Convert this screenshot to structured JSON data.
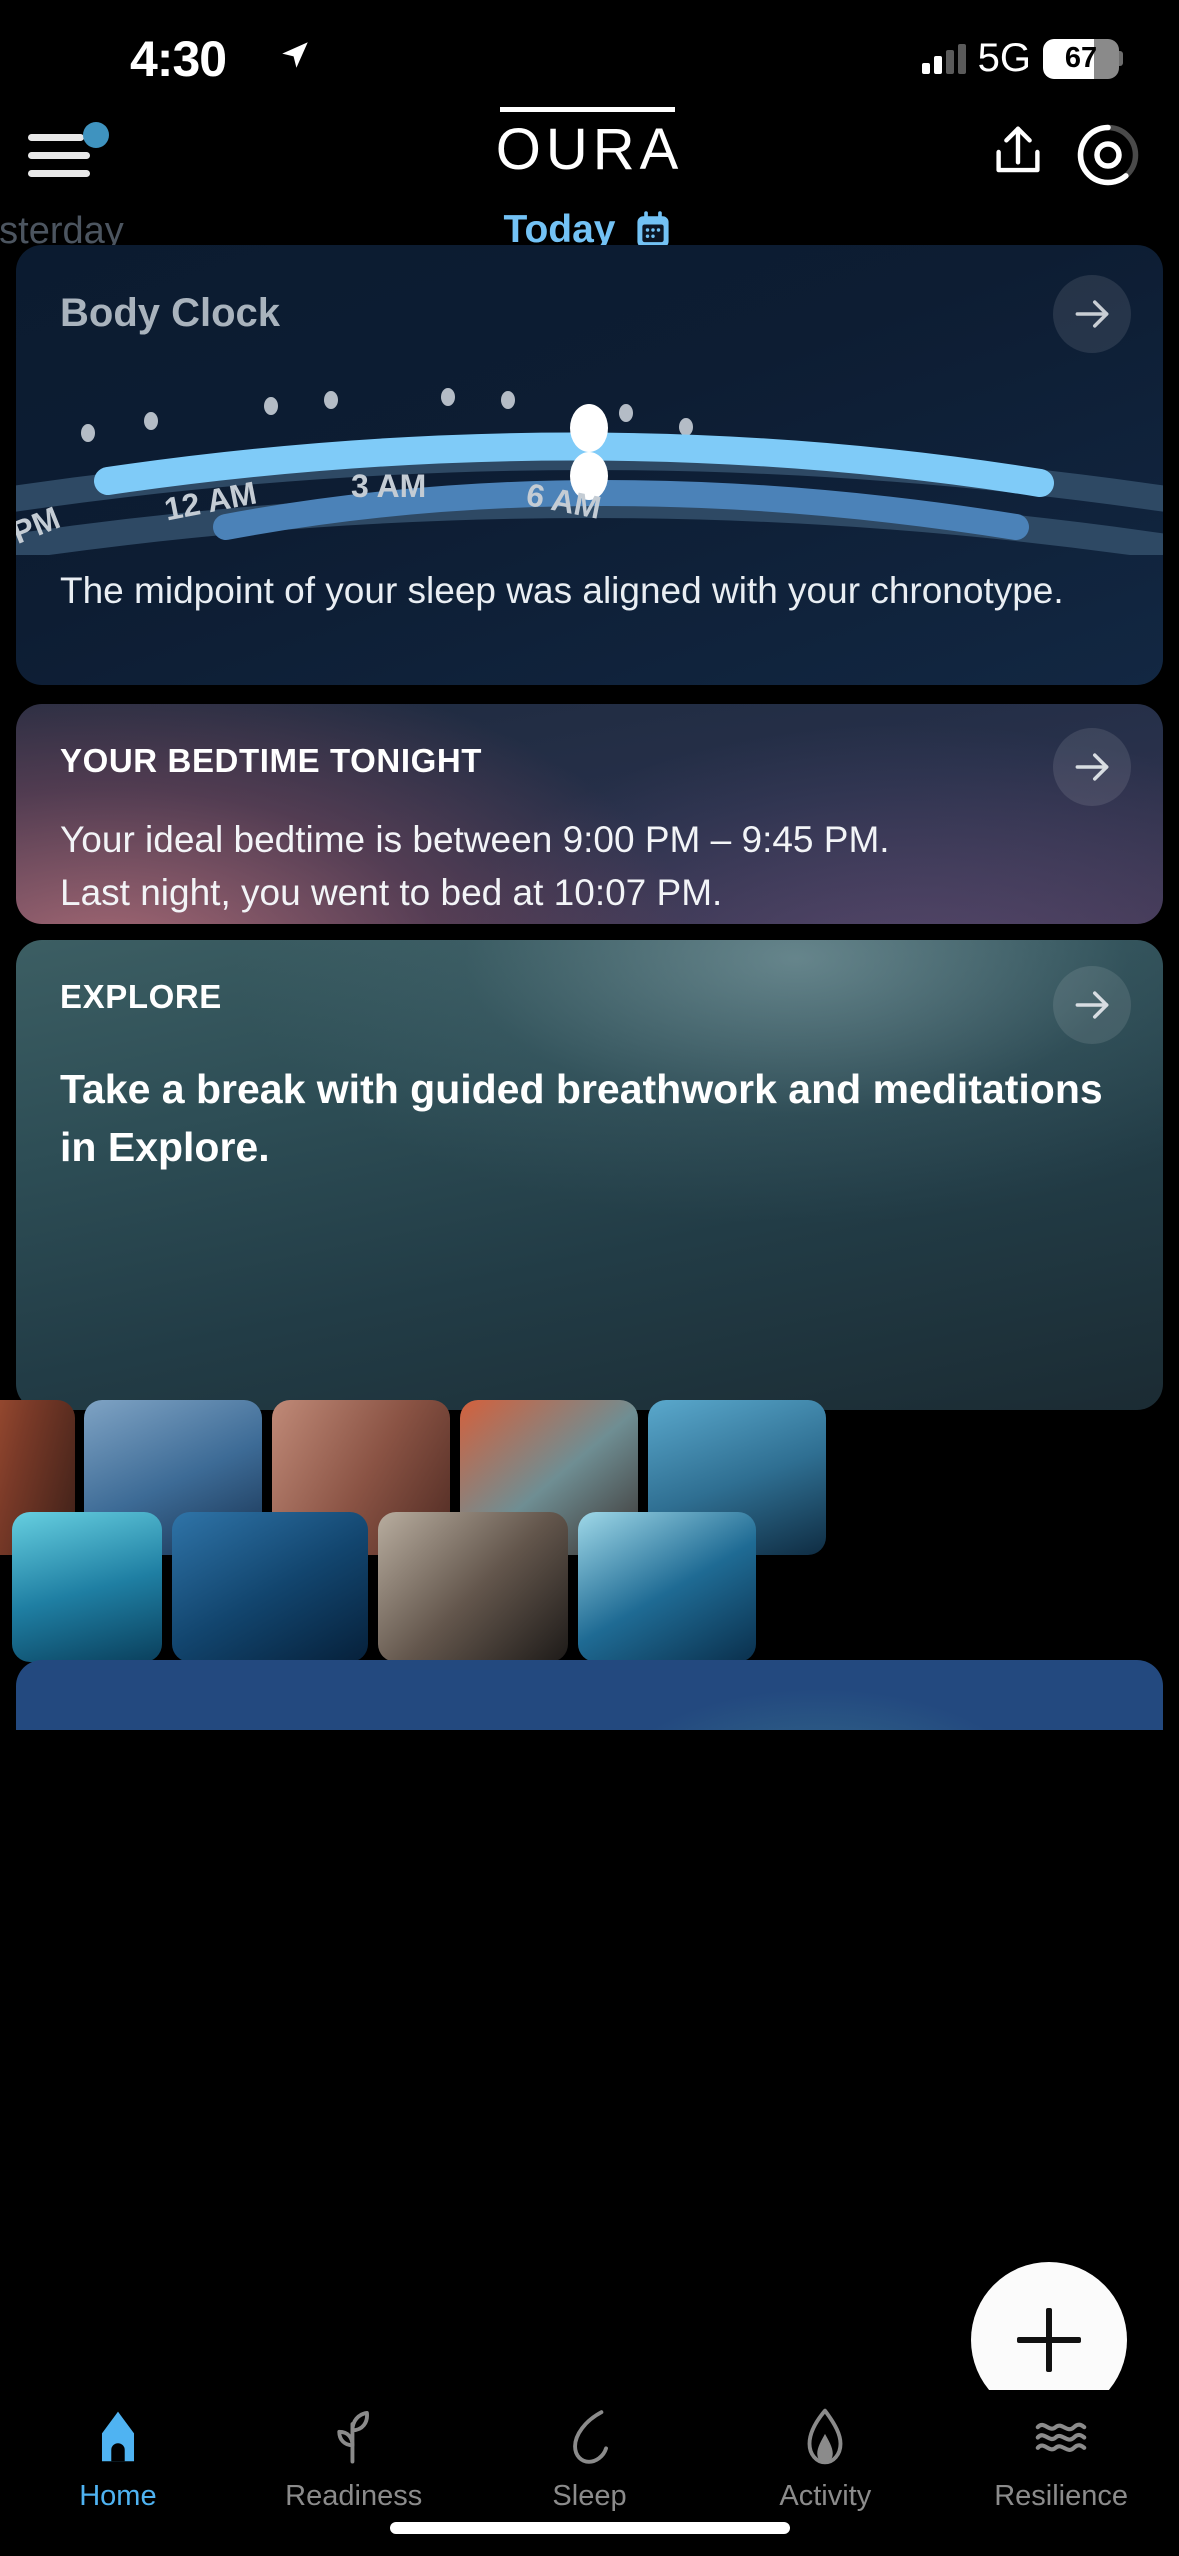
{
  "status_bar": {
    "time": "4:30",
    "location_icon": "location-arrow-icon",
    "network": "5G",
    "battery_percent": "67",
    "battery_level": 67,
    "signal_bars_filled": 2,
    "signal_bars_total": 4
  },
  "header": {
    "app_title": "OURA",
    "menu_icon": "hamburger-menu-icon",
    "menu_badge": true,
    "share_icon": "share-icon",
    "ring_icon": "ring-status-icon"
  },
  "day_tabs": {
    "previous": "esterday",
    "current": "Today",
    "calendar_icon": "calendar-icon",
    "active_color": "#73c2f5"
  },
  "body_clock": {
    "title": "Body Clock",
    "arrow_icon": "arrow-right-icon",
    "description": "The midpoint of your sleep was aligned with your chronotype.",
    "axis_labels": [
      "PM",
      "12 AM",
      "3 AM",
      "6 AM"
    ],
    "upper_arc_color": "#7fcbf8",
    "lower_arc_color": "#4b82b8",
    "track_color": "#2e4964",
    "marker_color": "#ffffff"
  },
  "bedtime": {
    "kicker": "YOUR BEDTIME TONIGHT",
    "arrow_icon": "arrow-right-icon",
    "line1": "Your ideal bedtime is between 9:00 PM – 9:45 PM.",
    "line2": "Last night, you went to bed at 10:07 PM.",
    "ideal_start": "9:00 PM",
    "ideal_end": "9:45 PM",
    "actual_bedtime": "10:07 PM"
  },
  "explore": {
    "kicker": "EXPLORE",
    "arrow_icon": "arrow-right-icon",
    "headline": "Take a break with guided breathwork and meditations in Explore.",
    "tiles_row1": [
      {
        "name": "tile-canyon-rust",
        "c1": "#c2603a",
        "c2": "#7a3a28",
        "c3": "#3d2018"
      },
      {
        "name": "tile-ocean-blue",
        "c1": "#7fa3c4",
        "c2": "#3d6b96",
        "c3": "#16304f"
      },
      {
        "name": "tile-dunes-rose",
        "c1": "#c08a78",
        "c2": "#8a5344",
        "c3": "#4e2a22"
      },
      {
        "name": "tile-clouds-orange",
        "c1": "#d4603c",
        "c2": "#6f8e93",
        "c3": "#3a3230"
      },
      {
        "name": "tile-ice-blue",
        "c1": "#5aa8cc",
        "c2": "#2f6f92",
        "c3": "#0f2c42"
      }
    ],
    "tiles_row2": [
      {
        "name": "tile-turquoise-surf",
        "c1": "#66cfe0",
        "c2": "#1f7fa3",
        "c3": "#0a3f5c"
      },
      {
        "name": "tile-deep-wave",
        "c1": "#2f74a8",
        "c2": "#12456e",
        "c3": "#06203a"
      },
      {
        "name": "tile-grey-wave",
        "c1": "#b8ad9f",
        "c2": "#63564c",
        "c3": "#1d1a18"
      },
      {
        "name": "tile-glacier",
        "c1": "#9fd8e8",
        "c2": "#1f6b94",
        "c3": "#0a2f4c"
      }
    ]
  },
  "fab": {
    "icon": "plus-icon",
    "label": "Add"
  },
  "bottom_nav": {
    "items": [
      {
        "label": "Home",
        "icon": "house-icon",
        "active": true
      },
      {
        "label": "Readiness",
        "icon": "sprout-icon",
        "active": false
      },
      {
        "label": "Sleep",
        "icon": "moon-icon",
        "active": false
      },
      {
        "label": "Activity",
        "icon": "flame-icon",
        "active": false
      },
      {
        "label": "Resilience",
        "icon": "waves-icon",
        "active": false
      }
    ],
    "active_color": "#4fb3f2",
    "inactive_color": "#8b8b8b"
  }
}
